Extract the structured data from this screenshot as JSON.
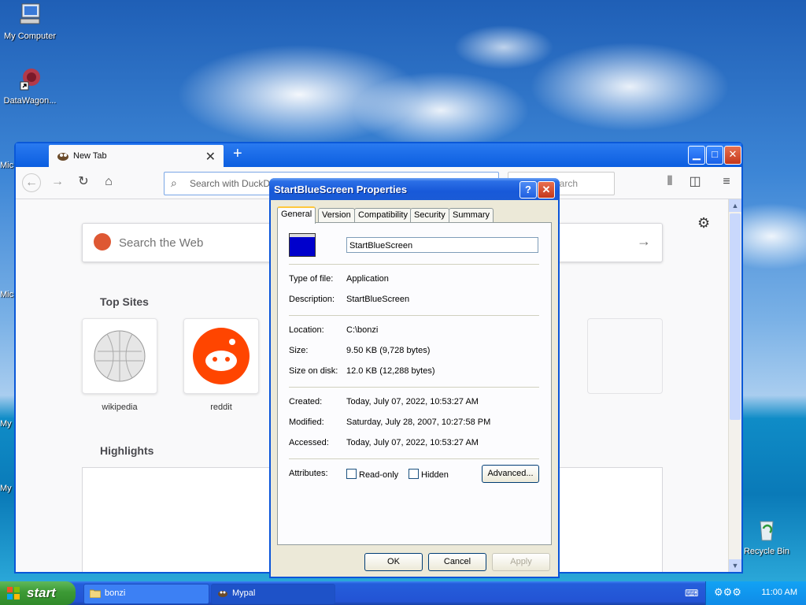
{
  "desktop": {
    "icons": [
      {
        "label": "My Computer"
      },
      {
        "label": "DataWagon..."
      },
      {
        "label": "Recycle Bin"
      }
    ],
    "edge_labels": [
      "Mic",
      "Mic",
      "My",
      "My"
    ]
  },
  "browser": {
    "tab_title": "New Tab",
    "new_tab": "+",
    "url_placeholder": "Search with DuckDuckGo or enter address",
    "search_placeholder": "Search",
    "web_search_placeholder": "Search the Web",
    "top_sites_heading": "Top Sites",
    "top_sites": [
      {
        "label": "wikipedia"
      },
      {
        "label": "reddit"
      }
    ],
    "highlights_heading": "Highlights"
  },
  "dialog": {
    "title": "StartBlueScreen Properties",
    "help": "?",
    "close": "✕",
    "tabs": [
      "General",
      "Version",
      "Compatibility",
      "Security",
      "Summary"
    ],
    "name_value": "StartBlueScreen",
    "fields": {
      "type_label": "Type of file:",
      "type_value": "Application",
      "desc_label": "Description:",
      "desc_value": "StartBlueScreen",
      "location_label": "Location:",
      "location_value": "C:\\bonzi",
      "size_label": "Size:",
      "size_value": "9.50 KB (9,728 bytes)",
      "disk_label": "Size on disk:",
      "disk_value": "12.0 KB (12,288 bytes)",
      "created_label": "Created:",
      "created_value": "Today, July 07, 2022, 10:53:27 AM",
      "modified_label": "Modified:",
      "modified_value": "Saturday, July 28, 2007, 10:27:58 PM",
      "accessed_label": "Accessed:",
      "accessed_value": "Today, July 07, 2022, 10:53:27 AM",
      "attributes_label": "Attributes:"
    },
    "readonly_label": "Read-only",
    "hidden_label": "Hidden",
    "advanced_label": "Advanced...",
    "ok_label": "OK",
    "cancel_label": "Cancel",
    "apply_label": "Apply"
  },
  "taskbar": {
    "start_label": "start",
    "tasks": [
      {
        "label": "bonzi"
      },
      {
        "label": "Mypal"
      }
    ],
    "clock": "11:00 AM"
  }
}
